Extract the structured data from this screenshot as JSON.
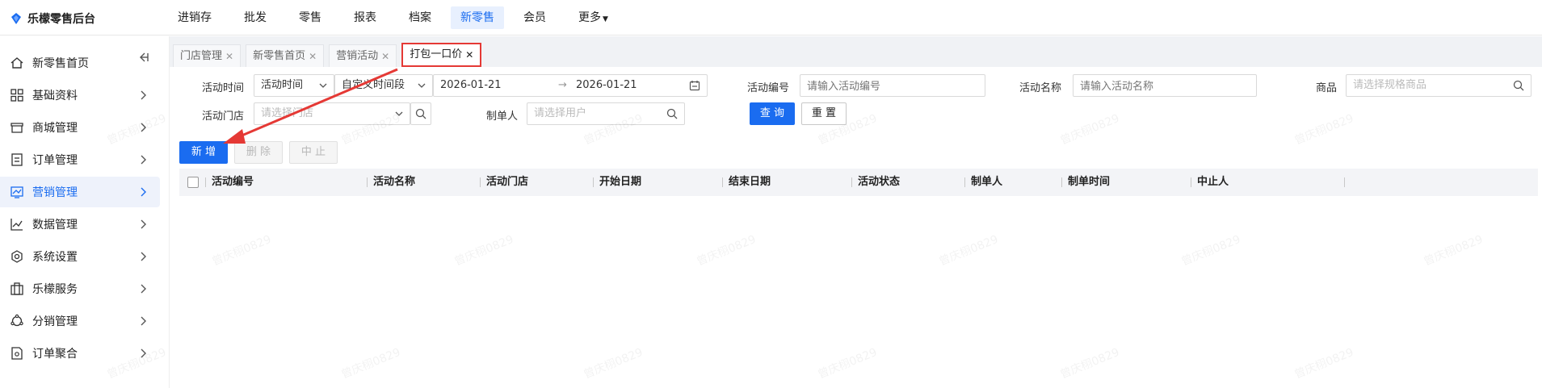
{
  "app": {
    "title": "乐檬零售后台"
  },
  "topnav": [
    {
      "label": "进销存"
    },
    {
      "label": "批发"
    },
    {
      "label": "零售"
    },
    {
      "label": "报表"
    },
    {
      "label": "档案"
    },
    {
      "label": "新零售"
    },
    {
      "label": "会员"
    },
    {
      "label": "更多"
    }
  ],
  "sidebar": {
    "items": [
      {
        "label": "新零售首页",
        "icon": "home-icon"
      },
      {
        "label": "基础资料",
        "icon": "grid-icon"
      },
      {
        "label": "商城管理",
        "icon": "store-icon"
      },
      {
        "label": "订单管理",
        "icon": "list-icon"
      },
      {
        "label": "营销管理",
        "icon": "chart-box-icon"
      },
      {
        "label": "数据管理",
        "icon": "line-chart-icon"
      },
      {
        "label": "系统设置",
        "icon": "gear-icon"
      },
      {
        "label": "乐檬服务",
        "icon": "building-icon"
      },
      {
        "label": "分销管理",
        "icon": "share-icon"
      },
      {
        "label": "订单聚合",
        "icon": "doc-gear-icon"
      }
    ]
  },
  "tabs": [
    {
      "label": "门店管理"
    },
    {
      "label": "新零售首页"
    },
    {
      "label": "营销活动"
    },
    {
      "label": "打包一口价"
    }
  ],
  "filters": {
    "activity_time_label": "活动时间",
    "activity_time_select": "活动时间",
    "range_select": "自定义时间段",
    "date_start": "2026-01-21",
    "date_end": "2026-01-21",
    "date_arrow": "→",
    "activity_no_label": "活动编号",
    "activity_no_placeholder": "请输入活动编号",
    "activity_name_label": "活动名称",
    "activity_name_placeholder": "请输入活动名称",
    "goods_label": "商品",
    "goods_placeholder": "请选择规格商品",
    "store_label": "活动门店",
    "store_placeholder": "请选择门店",
    "creator_label": "制单人",
    "creator_placeholder": "请选择用户",
    "query_label": "查 询",
    "reset_label": "重 置"
  },
  "actions": {
    "add_label": "新 增",
    "delete_label": "删 除",
    "stop_label": "中 止"
  },
  "table": {
    "columns": [
      "活动编号",
      "活动名称",
      "活动门店",
      "开始日期",
      "结束日期",
      "活动状态",
      "制单人",
      "制单时间",
      "中止人"
    ]
  },
  "watermark": {
    "text": "曾庆栩0829"
  },
  "colors": {
    "accent": "#1a6cf0",
    "annotation": "#e53935"
  }
}
